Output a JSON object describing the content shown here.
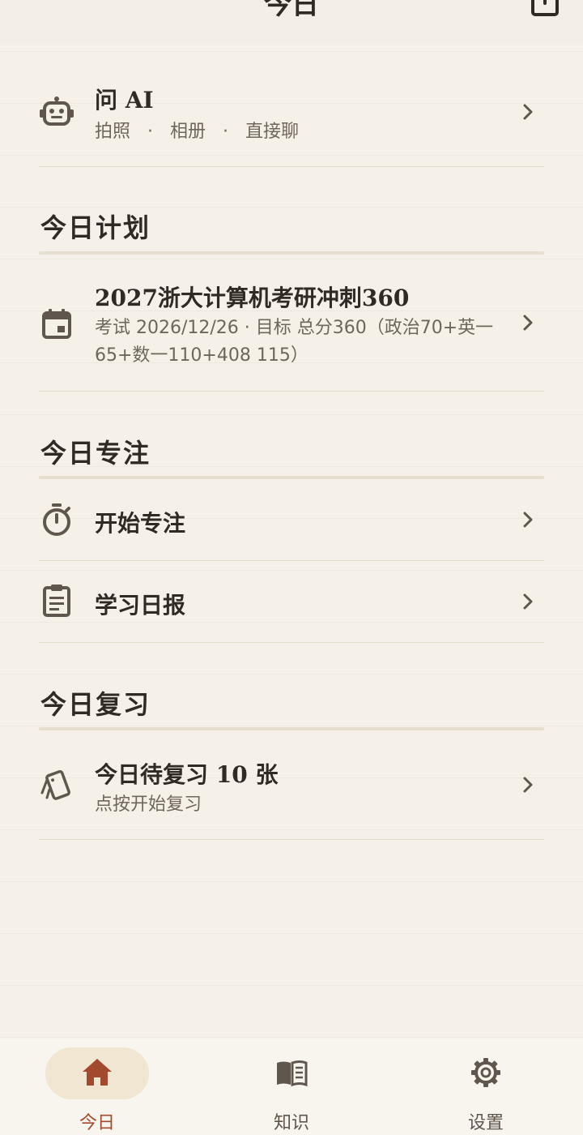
{
  "header": {
    "title": "今日"
  },
  "ask_ai": {
    "title": "问 AI",
    "options": [
      "拍照",
      "相册",
      "直接聊"
    ],
    "separator": "·"
  },
  "sections": {
    "plan": {
      "title": "今日计划",
      "item": {
        "title": "2027浙大计算机考研冲刺360",
        "subtitle": "考试 2026/12/26 · 目标 总分360（政治70+英一65+数一110+408 115）"
      }
    },
    "focus": {
      "title": "今日专注",
      "items": [
        {
          "label": "开始专注"
        },
        {
          "label": "学习日报"
        }
      ]
    },
    "review": {
      "title": "今日复习",
      "item": {
        "title": "今日待复习 10 张",
        "subtitle": "点按开始复习"
      }
    }
  },
  "tabs": [
    {
      "label": "今日",
      "active": true,
      "icon": "home-icon"
    },
    {
      "label": "知识",
      "active": false,
      "icon": "book-icon"
    },
    {
      "label": "设置",
      "active": false,
      "icon": "gear-icon"
    }
  ],
  "colors": {
    "background": "#f5f1e9",
    "accent": "#a34a2e",
    "icon": "#5f574d",
    "pill": "#f1e6d2"
  }
}
